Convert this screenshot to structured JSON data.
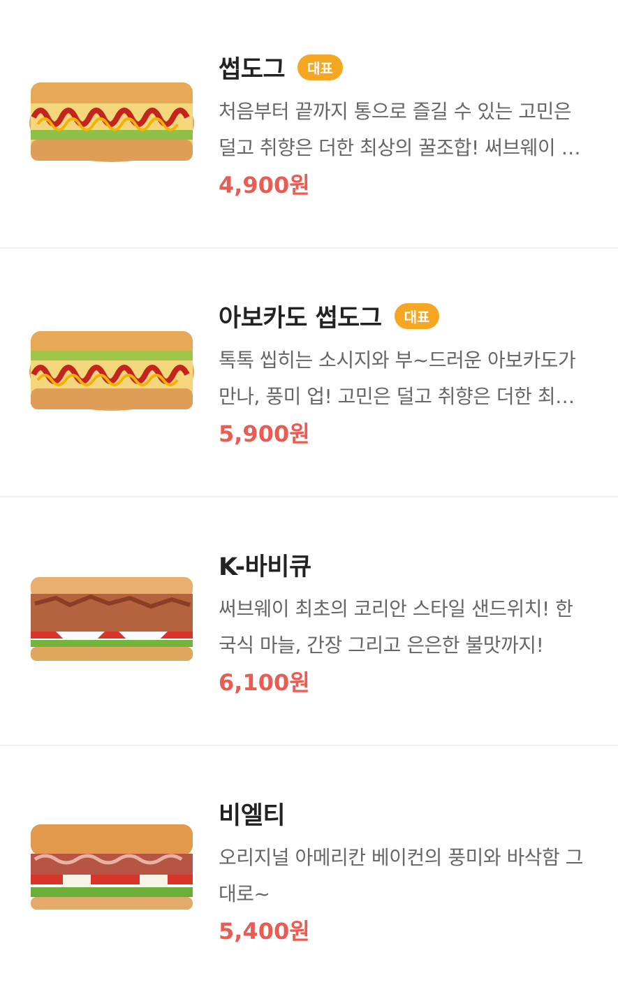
{
  "menu": {
    "items": [
      {
        "name": "썹도그",
        "badge": "대표",
        "description": "처음부터 끝까지 통으로 즐길 수 있는 고민은 덜고 취향은 더한 최상의 꿀조합! 써브웨이 썹도그",
        "price": "4,900원",
        "image": "hotdog-sandwich-image"
      },
      {
        "name": "아보카도 썹도그",
        "badge": "대표",
        "description": "톡톡 씹히는 소시지와 부~드러운 아보카도가 만나, 풍미 업! 고민은 덜고 취향은 더한 최상의 꿀조합",
        "price": "5,900원",
        "image": "avocado-hotdog-sandwich-image"
      },
      {
        "name": "K-바비큐",
        "badge": "",
        "description": "써브웨이 최초의 코리안 스타일 샌드위치! 한국식 마늘, 간장 그리고 은은한 불맛까지!",
        "price": "6,100원",
        "image": "k-bbq-sandwich-image"
      },
      {
        "name": "비엘티",
        "badge": "",
        "description": "오리지널 아메리칸 베이컨의 풍미와 바삭함 그대로~",
        "price": "5,400원",
        "image": "blt-sandwich-image"
      }
    ]
  },
  "colors": {
    "price": "#e85c52",
    "badge": "#f5a623",
    "divider": "#efefef"
  }
}
